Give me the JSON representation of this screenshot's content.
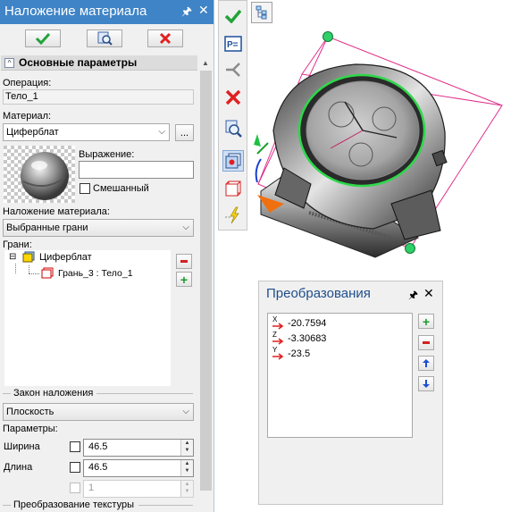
{
  "panel": {
    "title": "Наложение материала",
    "section_title": "Основные параметры",
    "operation_label": "Операция:",
    "operation_value": "Тело_1",
    "material_label": "Материал:",
    "material_value": "Циферблат",
    "more_button": "...",
    "expression_label": "Выражение:",
    "expression_value": "",
    "mixed_label": "Смешанный",
    "mapping_label": "Наложение материала:",
    "mapping_value": "Выбранные грани",
    "faces_label": "Грани:",
    "tree": {
      "root": "Циферблат",
      "child": "Грань_3 : Тело_1"
    },
    "law_section": "Закон наложения",
    "law_value": "Плоскость",
    "params_label": "Параметры:",
    "width_label": "Ширина",
    "width_value": "46.5",
    "length_label": "Длина",
    "length_value": "46.5",
    "third_value": "1",
    "texture_section": "Преобразование текстуры"
  },
  "transform": {
    "title": "Преобразования",
    "rows": [
      {
        "axis": "X",
        "value": "-20.7594"
      },
      {
        "axis": "Z",
        "value": "-3.30683"
      },
      {
        "axis": "Y",
        "value": "-23.5"
      }
    ]
  },
  "icons": {
    "ok": "check-icon",
    "preview": "preview-icon",
    "cancel": "cancel-icon"
  },
  "colors": {
    "title_bar": "#3f84c6",
    "ok_green": "#22a33a",
    "cancel_red": "#e02020",
    "selection_magenta": "#e0308a",
    "highlight_green": "#2ed84a"
  }
}
